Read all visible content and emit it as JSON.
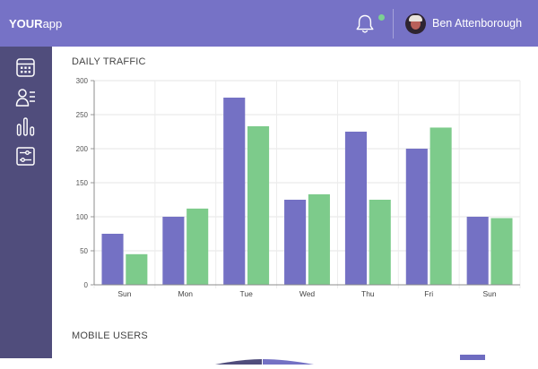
{
  "app": {
    "brand_bold": "YOUR",
    "brand_rest": "app"
  },
  "header": {
    "user_name": "Ben Attenborough",
    "notification_dot_color": "#7cd093"
  },
  "sidebar": {
    "items": [
      {
        "icon": "calendar-icon"
      },
      {
        "icon": "users-list-icon"
      },
      {
        "icon": "bar-chart-icon"
      },
      {
        "icon": "sliders-icon"
      }
    ]
  },
  "sections": {
    "traffic_title": "DAILY TRAFFIC",
    "mobile_title": "MOBILE USERS"
  },
  "colors": {
    "accent": "#7672c6",
    "sidebar": "#504d7c",
    "series_a": "#7471c4",
    "series_b": "#7dcb8b"
  },
  "chart_data": {
    "type": "bar",
    "title": "DAILY TRAFFIC",
    "categories": [
      "Sun",
      "Mon",
      "Tue",
      "Wed",
      "Thu",
      "Fri",
      "Sun"
    ],
    "series": [
      {
        "color": "#7471c4",
        "values": [
          75,
          100,
          275,
          125,
          225,
          200,
          100
        ]
      },
      {
        "color": "#7dcb8b",
        "values": [
          45,
          112,
          233,
          133,
          125,
          231,
          98
        ]
      }
    ],
    "ylim": [
      0,
      300
    ],
    "yticks": [
      0,
      50,
      100,
      150,
      200,
      250,
      300
    ],
    "grid": true
  }
}
